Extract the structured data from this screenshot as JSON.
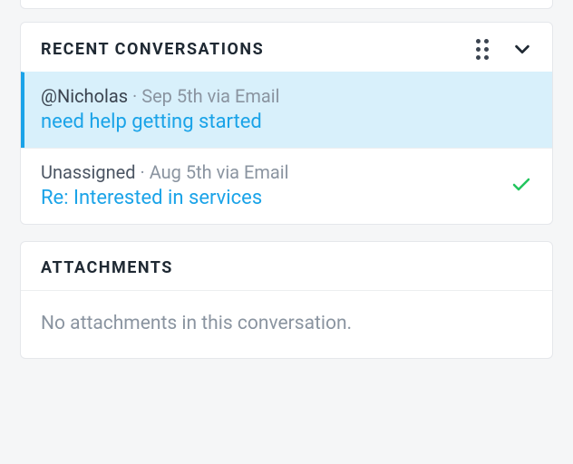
{
  "recent_conversations": {
    "title": "Recent Conversations",
    "items": [
      {
        "assignee": "@Nicholas",
        "meta_rest": " · Sep 5th via Email",
        "subject": "need help getting started",
        "active": true,
        "resolved": false
      },
      {
        "assignee": "Unassigned",
        "meta_rest": " · Aug 5th via Email",
        "subject": "Re: Interested in services",
        "active": false,
        "resolved": true
      }
    ]
  },
  "attachments": {
    "title": "Attachments",
    "empty_text": "No attachments in this conversation."
  }
}
